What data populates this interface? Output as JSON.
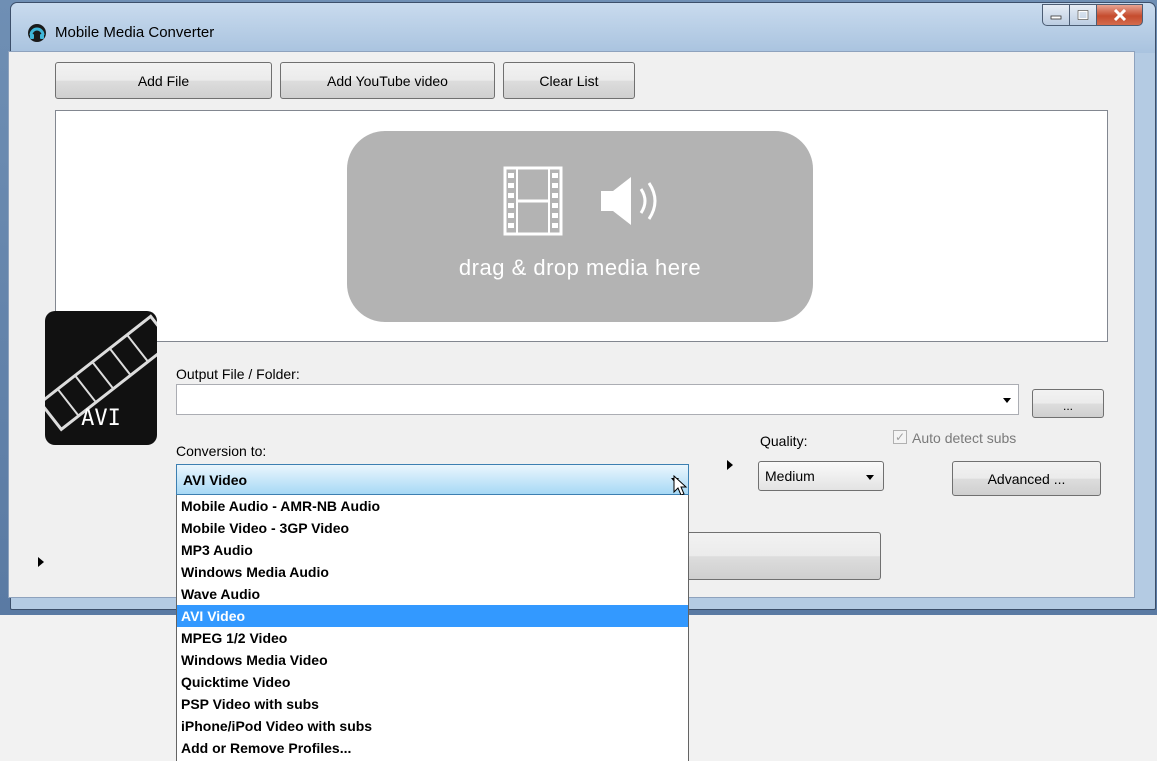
{
  "window": {
    "title": "Mobile Media Converter"
  },
  "toolbar": {
    "add_file": "Add File",
    "add_youtube": "Add YouTube video",
    "clear_list": "Clear List"
  },
  "drop_area": {
    "text": "drag & drop media here"
  },
  "format_icon": {
    "label": "AVI"
  },
  "output": {
    "label": "Output File / Folder:",
    "value": "",
    "browse_label": "..."
  },
  "conversion": {
    "label": "Conversion to:",
    "selected": "AVI Video",
    "options": [
      "Mobile Audio - AMR-NB Audio",
      "Mobile Video - 3GP Video",
      "MP3 Audio",
      "Windows Media Audio",
      "Wave Audio",
      "AVI Video",
      "MPEG 1/2 Video",
      "Windows Media Video",
      "Quicktime Video",
      "PSP Video with subs",
      "iPhone/iPod Video with subs",
      "Add or Remove Profiles..."
    ],
    "selected_index": 5
  },
  "quality": {
    "label": "Quality:",
    "selected": "Medium"
  },
  "subs": {
    "label": "Auto detect subs",
    "checked": true
  },
  "advanced": {
    "label": "Advanced ..."
  },
  "colors": {
    "selection": "#3399ff",
    "drop_box": "#b3b3b3"
  }
}
